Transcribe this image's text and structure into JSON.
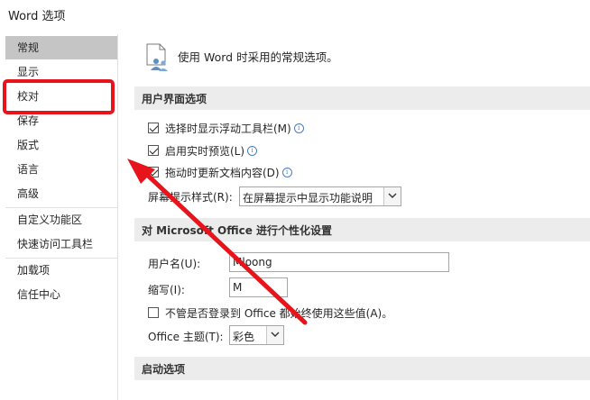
{
  "window": {
    "title": "Word 选项"
  },
  "sidebar": {
    "items": [
      {
        "label": "常规"
      },
      {
        "label": "显示"
      },
      {
        "label": "校对"
      },
      {
        "label": "保存"
      },
      {
        "label": "版式"
      },
      {
        "label": "语言"
      },
      {
        "label": "高级"
      },
      {
        "label": "自定义功能区"
      },
      {
        "label": "快速访问工具栏"
      },
      {
        "label": "加载项"
      },
      {
        "label": "信任中心"
      }
    ],
    "active_item": "常规",
    "highlighted_item": "校对"
  },
  "main": {
    "header": "使用 Word 时采用的常规选项。",
    "ui_section": {
      "title": "用户界面选项",
      "options": [
        {
          "label": "选择时显示浮动工具栏(M)",
          "checked": true,
          "info": "i"
        },
        {
          "label": "启用实时预览(L)",
          "checked": true,
          "info": "i"
        },
        {
          "label": "拖动时更新文档内容(D)",
          "checked": true,
          "info": "i"
        }
      ],
      "screentip_label": "屏幕提示样式(R):",
      "screentip_value": "在屏幕提示中显示功能说明"
    },
    "personalize_section": {
      "title": "对 Microsoft Office 进行个性化设置",
      "username_label": "用户名(U):",
      "username_value": "Mloong",
      "initials_label": "缩写(I):",
      "initials_value": "M",
      "always_use_label": "不管是否登录到 Office 都始终使用这些值(A)。",
      "always_use_checked": false,
      "theme_label": "Office 主题(T):",
      "theme_value": "彩色"
    },
    "startup_section": {
      "title": "启动选项"
    }
  },
  "colors": {
    "annotation_red": "#e8141c",
    "active_nav_bg": "#c5c5c5",
    "section_bg": "#ececec"
  }
}
